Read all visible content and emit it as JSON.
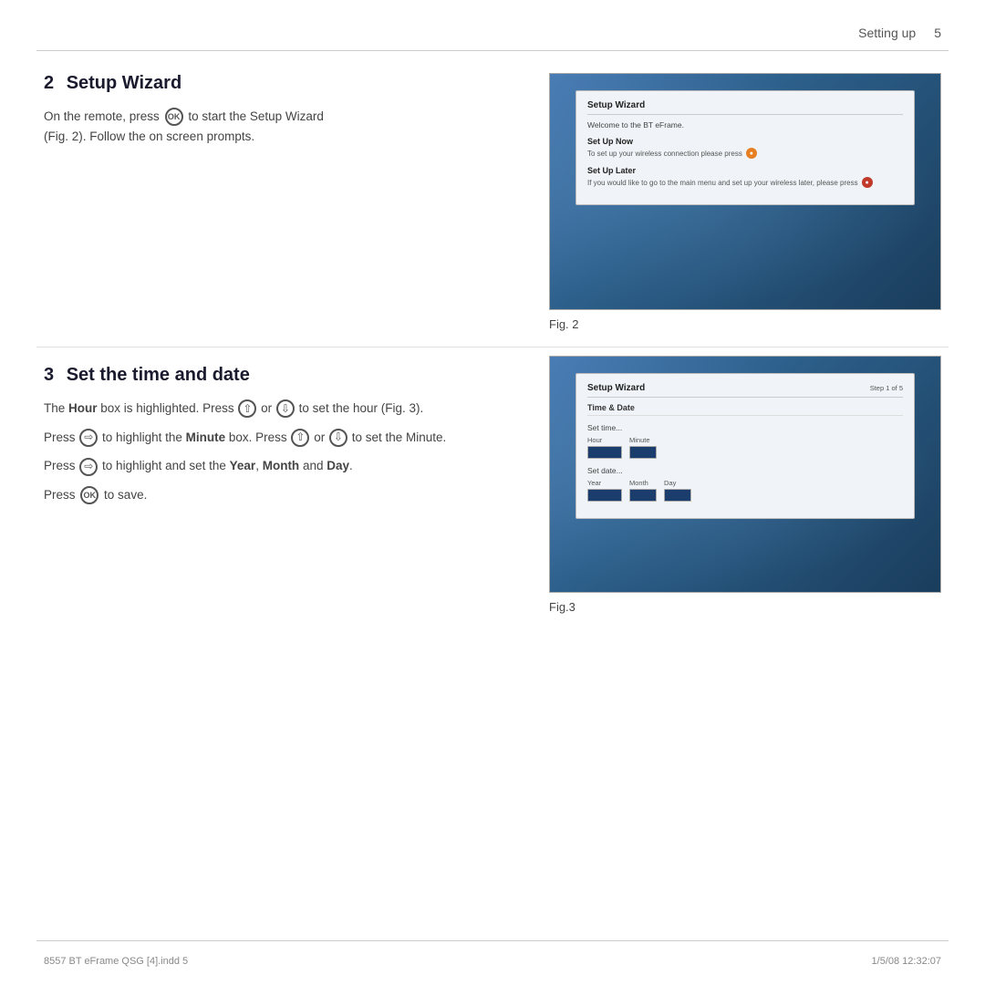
{
  "header": {
    "section": "Setting up",
    "page_number": "5"
  },
  "section2": {
    "number": "2",
    "title": "Setup Wizard",
    "body_line1": "On the remote, press",
    "ok_label": "OK",
    "body_line1b": "to start the Setup Wizard",
    "body_line2": "(Fig. 2). Follow the on screen prompts."
  },
  "figure2": {
    "label": "Fig. 2",
    "dialog": {
      "title": "Setup Wizard",
      "welcome": "Welcome to the BT eFrame.",
      "option1_title": "Set Up Now",
      "option1_desc": "To set up your wireless connection please press",
      "option2_title": "Set Up Later",
      "option2_desc": "If you would like to go to the main menu and set up your wireless later, please press"
    }
  },
  "section3": {
    "number": "3",
    "title": "Set the time and date",
    "para1_a": "The ",
    "para1_bold": "Hour",
    "para1_b": " box is highlighted. Press",
    "para1_up": "▲",
    "para1_or": " or ",
    "para1_down": "▼",
    "para1_c": " to set the hour (Fig. 3).",
    "para2_a": "Press",
    "para2_right": "▶",
    "para2_b": " to highlight the ",
    "para2_bold": "Minute",
    "para2_c": " box. Press",
    "para2_up2": "▲",
    "para2_or2": " or ",
    "para2_down2": "▼",
    "para2_d": " to set the Minute.",
    "para3_a": "Press",
    "para3_right": "▶",
    "para3_b": " to highlight and set the ",
    "para3_bold1": "Year",
    "para3_comma": ", ",
    "para3_bold2": "Month",
    "para3_and": " and ",
    "para3_bold3": "Day",
    "para3_dot": ".",
    "para4_a": "Press",
    "para4_ok": "OK",
    "para4_b": " to save."
  },
  "figure3": {
    "label": "Fig.3",
    "dialog": {
      "title": "Setup Wizard",
      "nav": "Step 1 of 5",
      "tab": "Time & Date",
      "set_time_label": "Set time...",
      "hour_label": "Hour",
      "minute_label": "Minute",
      "set_date_label": "Set date...",
      "year_label": "Year",
      "month_label": "Month",
      "day_label": "Day"
    }
  },
  "footer": {
    "left": "8557 BT eFrame QSG [4].indd   5",
    "right": "1/5/08   12:32:07"
  }
}
